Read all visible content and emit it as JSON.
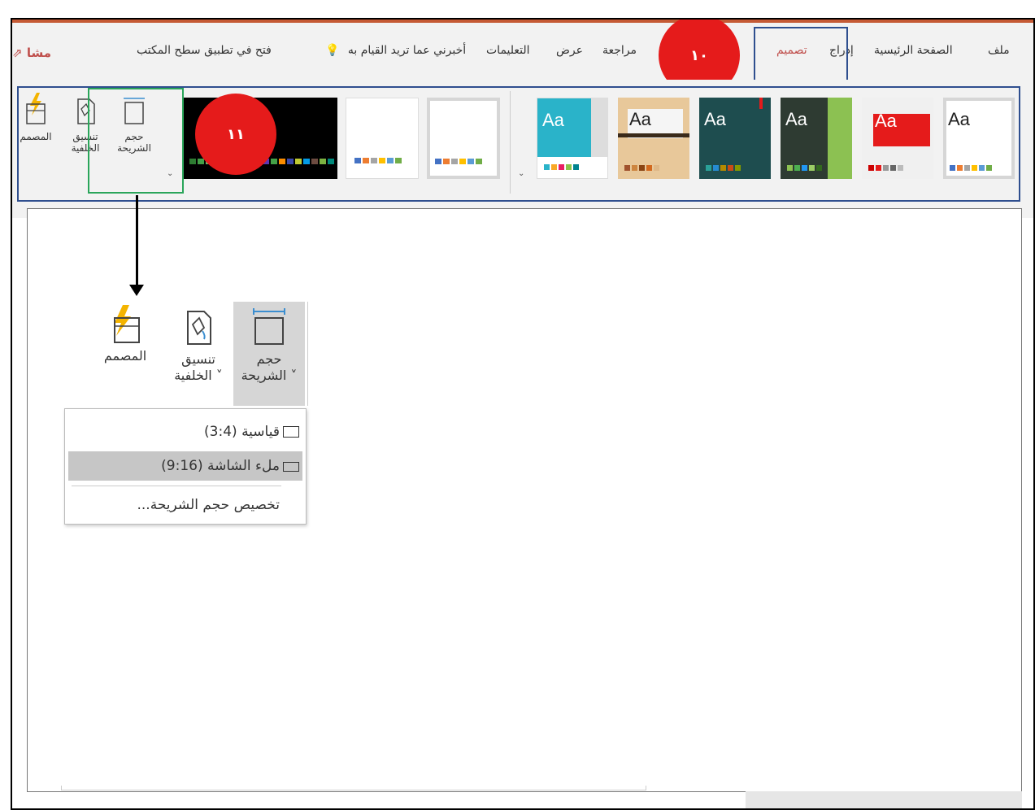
{
  "menu": {
    "file": "ملف",
    "home": "الصفحة الرئيسية",
    "insert": "إدراج",
    "design": "تصميم",
    "review": "مراجعة",
    "view": "عرض",
    "help": "التعليمات",
    "tell_me": "أخبرني عما تريد القيام به",
    "open_desktop": "فتح في تطبيق سطح المكتب",
    "share": "مشا"
  },
  "markers": {
    "design_step": "١٠",
    "slide_size_step": "١١"
  },
  "ribbon": {
    "themes_label": "Aa",
    "slide_size": "حجم الشريحة",
    "format_background": "تنسيق الخلفية",
    "designer": "المصمم"
  },
  "zoomed": {
    "slide_size_line1": "حجم",
    "slide_size_line2": "الشريحة ˅",
    "format_bg_line1": "تنسيق",
    "format_bg_line2": "الخلفية ˅",
    "designer": "المصمم"
  },
  "dropdown": {
    "standard": "قياسية (3:4)",
    "widescreen": "ملء الشاشة (9:16)",
    "custom": "تخصيص حجم الشريحة..."
  },
  "colors": {
    "accent": "#c0504d",
    "step_marker": "#e51b1b",
    "highlight_box": "#2f4f8f",
    "green_box": "#2aa55a"
  }
}
